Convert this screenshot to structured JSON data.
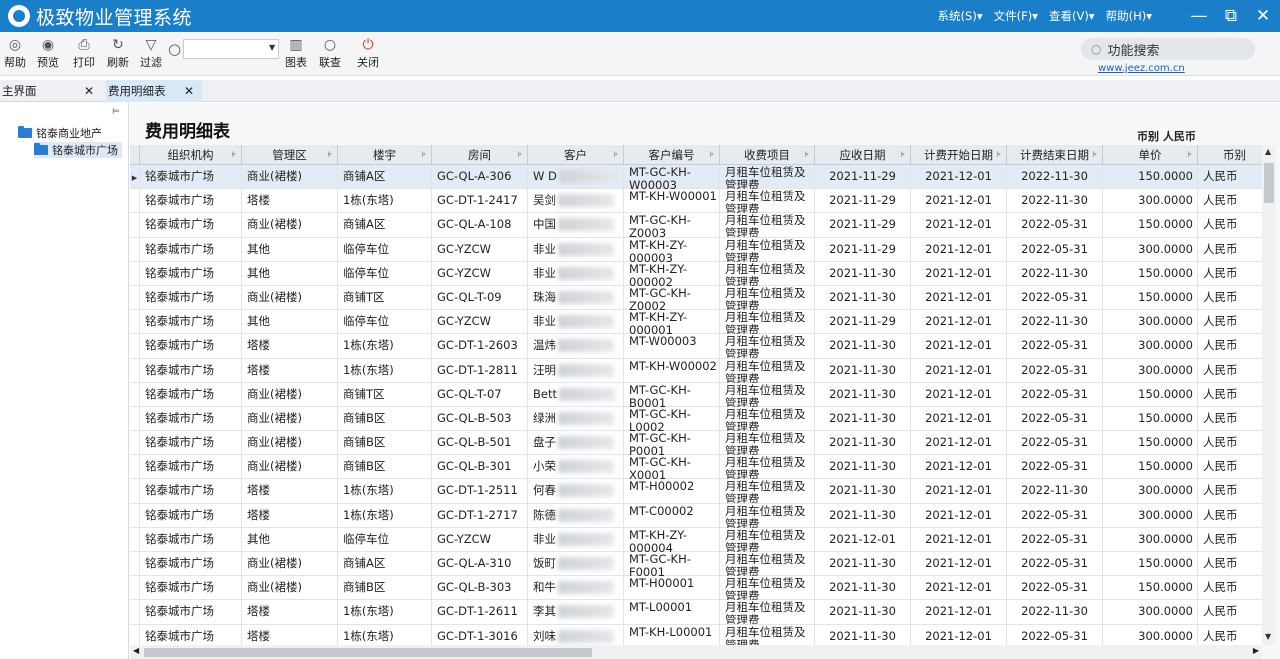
{
  "app": {
    "title": "极致物业管理系统",
    "menus": [
      "系统(S)▾",
      "文件(F)▾",
      "查看(V)▾",
      "帮助(H)▾"
    ],
    "window_controls": {
      "minimize": "—",
      "restore": "⧉",
      "close": "✕"
    }
  },
  "toolbar": {
    "buttons": [
      {
        "label": "帮助",
        "icon": "help-icon",
        "glyph": "◎"
      },
      {
        "label": "预览",
        "icon": "eye-icon",
        "glyph": "◉"
      },
      {
        "label": "打印",
        "icon": "printer-icon",
        "glyph": "⎙"
      },
      {
        "label": "刷新",
        "icon": "refresh-icon",
        "glyph": "↻"
      },
      {
        "label": "过滤",
        "icon": "filter-icon",
        "glyph": "▽"
      }
    ],
    "search_value": "",
    "right_buttons": [
      {
        "label": "图表",
        "icon": "chart-icon",
        "glyph": "▥"
      },
      {
        "label": "联查",
        "icon": "search-icon",
        "glyph": "○"
      },
      {
        "label": "关闭",
        "icon": "power-icon",
        "glyph": "⏻"
      }
    ],
    "function_search": "功能搜索",
    "site_link": "www.jeez.com.cn"
  },
  "tabs": [
    {
      "label": "主界面",
      "active": false
    },
    {
      "label": "费用明细表",
      "active": true
    }
  ],
  "sidebar": {
    "tree": [
      {
        "label": "铭泰商业地产",
        "level": 0
      },
      {
        "label": "铭泰城市广场",
        "level": 1,
        "selected": true
      }
    ]
  },
  "report": {
    "title": "费用明细表",
    "currency_label": "币别 人民币",
    "columns": [
      "组织机构",
      "管理区",
      "楼宇",
      "房间",
      "客户",
      "客户编号",
      "收费项目",
      "应收日期",
      "计费开始日期",
      "计费结束日期",
      "单价",
      "币别"
    ],
    "rows": [
      [
        "铭泰城市广场",
        "商业(裙楼)",
        "商铺A区",
        "GC-QL-A-306",
        "W D",
        "MT-GC-KH-W00003",
        "月租车位租赁及管理费",
        "2021-11-29",
        "2021-12-01",
        "2022-11-30",
        "150.0000",
        "人民币"
      ],
      [
        "铭泰城市广场",
        "塔楼",
        "1栋(东塔)",
        "GC-DT-1-2417",
        "吴剑",
        "MT-KH-W00001",
        "月租车位租赁及管理费",
        "2021-11-29",
        "2021-12-01",
        "2022-11-30",
        "300.0000",
        "人民币"
      ],
      [
        "铭泰城市广场",
        "商业(裙楼)",
        "商铺A区",
        "GC-QL-A-108",
        "中国",
        "MT-GC-KH-Z0003",
        "月租车位租赁及管理费",
        "2021-11-29",
        "2021-12-01",
        "2022-05-31",
        "150.0000",
        "人民币"
      ],
      [
        "铭泰城市广场",
        "其他",
        "临停车位",
        "GC-YZCW",
        "非业",
        "MT-KH-ZY-000003",
        "月租车位租赁及管理费",
        "2021-11-29",
        "2021-12-01",
        "2022-05-31",
        "300.0000",
        "人民币"
      ],
      [
        "铭泰城市广场",
        "其他",
        "临停车位",
        "GC-YZCW",
        "非业",
        "MT-KH-ZY-000002",
        "月租车位租赁及管理费",
        "2021-11-30",
        "2021-12-01",
        "2022-11-30",
        "150.0000",
        "人民币"
      ],
      [
        "铭泰城市广场",
        "商业(裙楼)",
        "商铺T区",
        "GC-QL-T-09",
        "珠海",
        "MT-GC-KH-Z0002",
        "月租车位租赁及管理费",
        "2021-11-30",
        "2021-12-01",
        "2022-05-31",
        "150.0000",
        "人民币"
      ],
      [
        "铭泰城市广场",
        "其他",
        "临停车位",
        "GC-YZCW",
        "非业",
        "MT-KH-ZY-000001",
        "月租车位租赁及管理费",
        "2021-11-29",
        "2021-12-01",
        "2022-11-30",
        "300.0000",
        "人民币"
      ],
      [
        "铭泰城市广场",
        "塔楼",
        "1栋(东塔)",
        "GC-DT-1-2603",
        "温炜",
        "MT-W00003",
        "月租车位租赁及管理费",
        "2021-11-30",
        "2021-12-01",
        "2022-05-31",
        "300.0000",
        "人民币"
      ],
      [
        "铭泰城市广场",
        "塔楼",
        "1栋(东塔)",
        "GC-DT-1-2811",
        "汪明",
        "MT-KH-W00002",
        "月租车位租赁及管理费",
        "2021-11-30",
        "2021-12-01",
        "2022-05-31",
        "300.0000",
        "人民币"
      ],
      [
        "铭泰城市广场",
        "商业(裙楼)",
        "商铺T区",
        "GC-QL-T-07",
        "Bett",
        "MT-GC-KH-B0001",
        "月租车位租赁及管理费",
        "2021-11-30",
        "2021-12-01",
        "2022-05-31",
        "150.0000",
        "人民币"
      ],
      [
        "铭泰城市广场",
        "商业(裙楼)",
        "商铺B区",
        "GC-QL-B-503",
        "绿洲",
        "MT-GC-KH-L0002",
        "月租车位租赁及管理费",
        "2021-11-30",
        "2021-12-01",
        "2022-05-31",
        "150.0000",
        "人民币"
      ],
      [
        "铭泰城市广场",
        "商业(裙楼)",
        "商铺B区",
        "GC-QL-B-501",
        "盘子",
        "MT-GC-KH-P0001",
        "月租车位租赁及管理费",
        "2021-11-30",
        "2021-12-01",
        "2022-05-31",
        "150.0000",
        "人民币"
      ],
      [
        "铭泰城市广场",
        "商业(裙楼)",
        "商铺B区",
        "GC-QL-B-301",
        "小荣",
        "MT-GC-KH-X0001",
        "月租车位租赁及管理费",
        "2021-11-30",
        "2021-12-01",
        "2022-05-31",
        "150.0000",
        "人民币"
      ],
      [
        "铭泰城市广场",
        "塔楼",
        "1栋(东塔)",
        "GC-DT-1-2511",
        "何春",
        "MT-H00002",
        "月租车位租赁及管理费",
        "2021-11-30",
        "2021-12-01",
        "2022-11-30",
        "300.0000",
        "人民币"
      ],
      [
        "铭泰城市广场",
        "塔楼",
        "1栋(东塔)",
        "GC-DT-1-2717",
        "陈德",
        "MT-C00002",
        "月租车位租赁及管理费",
        "2021-11-30",
        "2021-12-01",
        "2022-05-31",
        "300.0000",
        "人民币"
      ],
      [
        "铭泰城市广场",
        "其他",
        "临停车位",
        "GC-YZCW",
        "非业",
        "MT-KH-ZY-000004",
        "月租车位租赁及管理费",
        "2021-12-01",
        "2021-12-01",
        "2022-05-31",
        "300.0000",
        "人民币"
      ],
      [
        "铭泰城市广场",
        "商业(裙楼)",
        "商铺A区",
        "GC-QL-A-310",
        "饭町",
        "MT-GC-KH-F0001",
        "月租车位租赁及管理费",
        "2021-11-30",
        "2021-12-01",
        "2022-05-31",
        "150.0000",
        "人民币"
      ],
      [
        "铭泰城市广场",
        "商业(裙楼)",
        "商铺B区",
        "GC-QL-B-303",
        "和牛",
        "MT-H00001",
        "月租车位租赁及管理费",
        "2021-11-30",
        "2021-12-01",
        "2022-05-31",
        "150.0000",
        "人民币"
      ],
      [
        "铭泰城市广场",
        "塔楼",
        "1栋(东塔)",
        "GC-DT-1-2611",
        "李其",
        "MT-L00001",
        "月租车位租赁及管理费",
        "2021-11-30",
        "2021-12-01",
        "2022-11-30",
        "300.0000",
        "人民币"
      ],
      [
        "铭泰城市广场",
        "塔楼",
        "1栋(东塔)",
        "GC-DT-1-3016",
        "刘味",
        "MT-KH-L00001",
        "月租车位租赁及管理费",
        "2021-11-30",
        "2021-12-01",
        "2022-05-31",
        "300.0000",
        "人民币"
      ]
    ]
  },
  "colors": {
    "title_bar": "#1a7ec8",
    "selected_row": "#e3ecf6",
    "link": "#1a5fb4",
    "close_icon": "#e23b3b"
  }
}
